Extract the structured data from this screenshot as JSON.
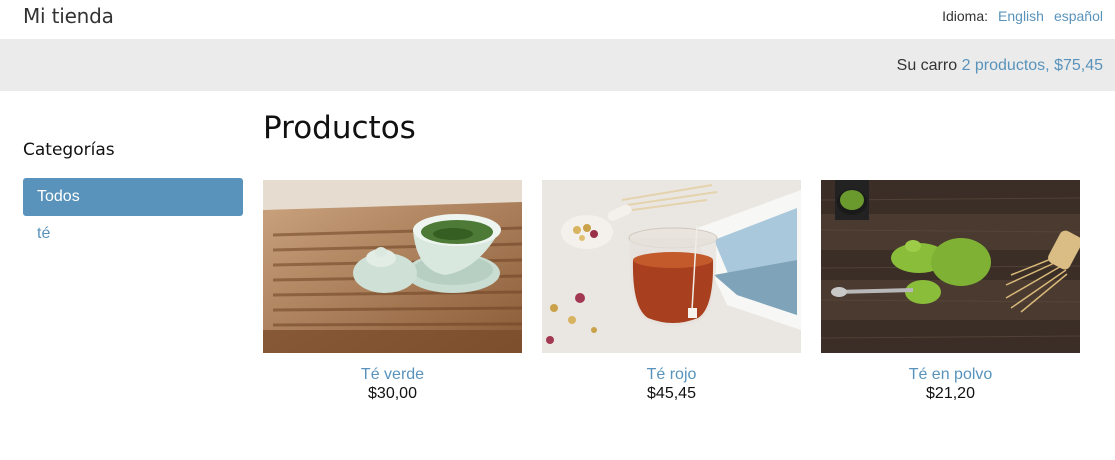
{
  "header": {
    "site_title": "Mi tienda",
    "language_label": "Idioma:",
    "languages": [
      "English",
      "español"
    ]
  },
  "cart": {
    "label": "Su carro",
    "summary": "2 productos, $75,45"
  },
  "sidebar": {
    "heading": "Categorías",
    "items": [
      {
        "label": "Todos",
        "active": true
      },
      {
        "label": "té",
        "active": false
      }
    ]
  },
  "main": {
    "title": "Productos",
    "products": [
      {
        "name": "Té verde",
        "price": "$30,00",
        "image": "green-tea-photo"
      },
      {
        "name": "Té rojo",
        "price": "$45,45",
        "image": "red-tea-photo"
      },
      {
        "name": "Té en polvo",
        "price": "$21,20",
        "image": "matcha-powder-photo"
      }
    ]
  },
  "colors": {
    "accent": "#5993bb",
    "cart_bar": "#ebebeb",
    "text": "#333333"
  }
}
